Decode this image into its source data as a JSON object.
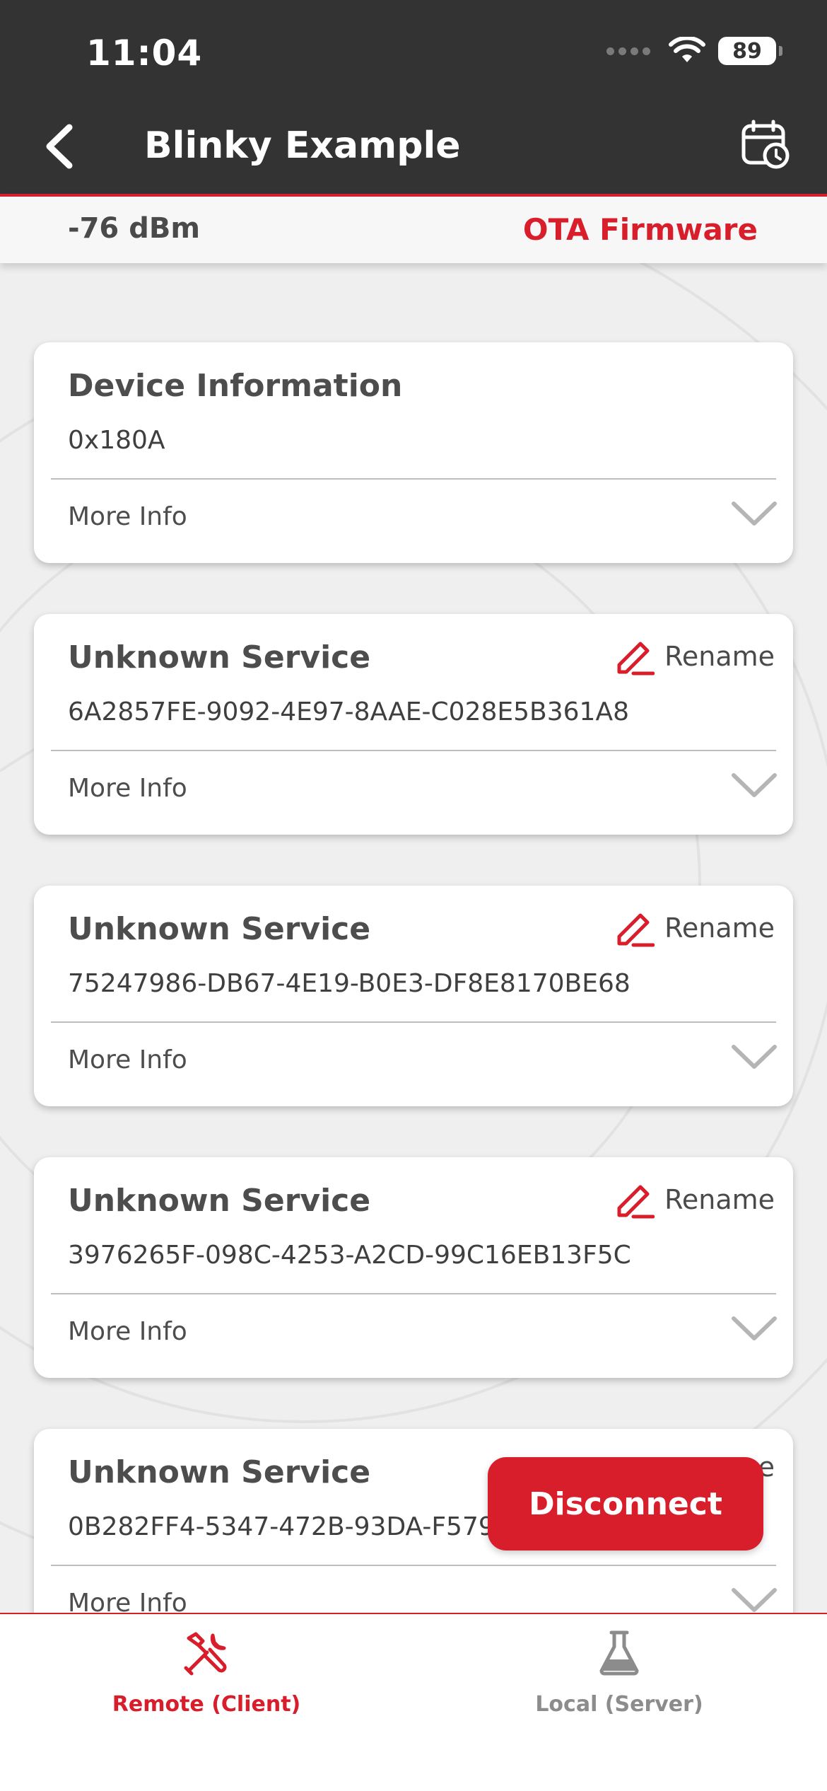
{
  "status_bar": {
    "time": "11:04",
    "battery": "89"
  },
  "nav": {
    "title": "Blinky Example"
  },
  "subheader": {
    "rssi": "-76 dBm",
    "ota_label": "OTA Firmware"
  },
  "services": [
    {
      "title": "Device Information",
      "uuid": "0x180A",
      "more": "More Info",
      "renamable": false
    },
    {
      "title": "Unknown Service",
      "uuid": "6A2857FE-9092-4E97-8AAE-C028E5B361A8",
      "more": "More Info",
      "renamable": true,
      "rename_label": "Rename"
    },
    {
      "title": "Unknown Service",
      "uuid": "75247986-DB67-4E19-B0E3-DF8E8170BE68",
      "more": "More Info",
      "renamable": true,
      "rename_label": "Rename"
    },
    {
      "title": "Unknown Service",
      "uuid": "3976265F-098C-4253-A2CD-99C16EB13F5C",
      "more": "More Info",
      "renamable": true,
      "rename_label": "Rename"
    },
    {
      "title": "Unknown Service",
      "uuid": "0B282FF4-5347-472B-93DA-F579",
      "more": "More Info",
      "renamable": true,
      "rename_label": "e"
    }
  ],
  "disconnect_label": "Disconnect",
  "tabs": [
    {
      "label": "Remote (Client)",
      "icon": "tools-icon",
      "active": true
    },
    {
      "label": "Local (Server)",
      "icon": "flask-icon",
      "active": false
    }
  ],
  "colors": {
    "accent": "#d91e2b",
    "header_bg": "#333333",
    "page_bg": "#efefef"
  }
}
